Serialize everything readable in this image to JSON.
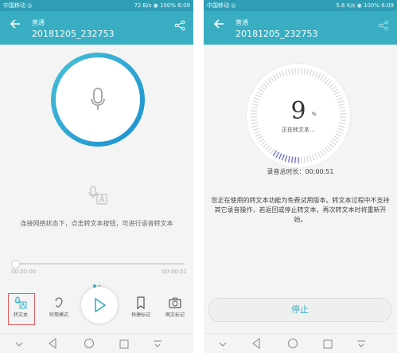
{
  "left": {
    "status": {
      "carrier": "中国移动 ◎",
      "net": "72 B/s",
      "battery": "100",
      "time": "6:09"
    },
    "header": {
      "title": "普通",
      "subtitle": "20181205_232753"
    },
    "hint": "连接网络状态下，点击转文本按钮，可进行语音转文本",
    "progress": {
      "elapsed": "00:00:00",
      "total": "00:00:51"
    },
    "toolbar": {
      "transcribe": "转文本",
      "earpiece": "听筒模式",
      "quick_mark": "快捷标记",
      "photo_mark": "图文标记"
    }
  },
  "right": {
    "status": {
      "carrier": "中国移动 ◎",
      "net": "5.6 K/s",
      "battery": "100",
      "time": "6:09"
    },
    "header": {
      "title": "普通",
      "subtitle": "20181205_232753"
    },
    "progress_value": "9",
    "percent_sign": "%",
    "converting_label": "正在转文本…",
    "total_label": "录音总时长：00:00:51",
    "info": "您正在使用的转文本功能为免费试用版本。转文本过程中不支持其它录音操作，若返回或停止转文本，再次转文本时将重新开始。",
    "stop_label": "停止"
  },
  "colors": {
    "accent": "#39aec3",
    "status_bar": "#2f9eb4",
    "highlight": "#e25c5c"
  }
}
